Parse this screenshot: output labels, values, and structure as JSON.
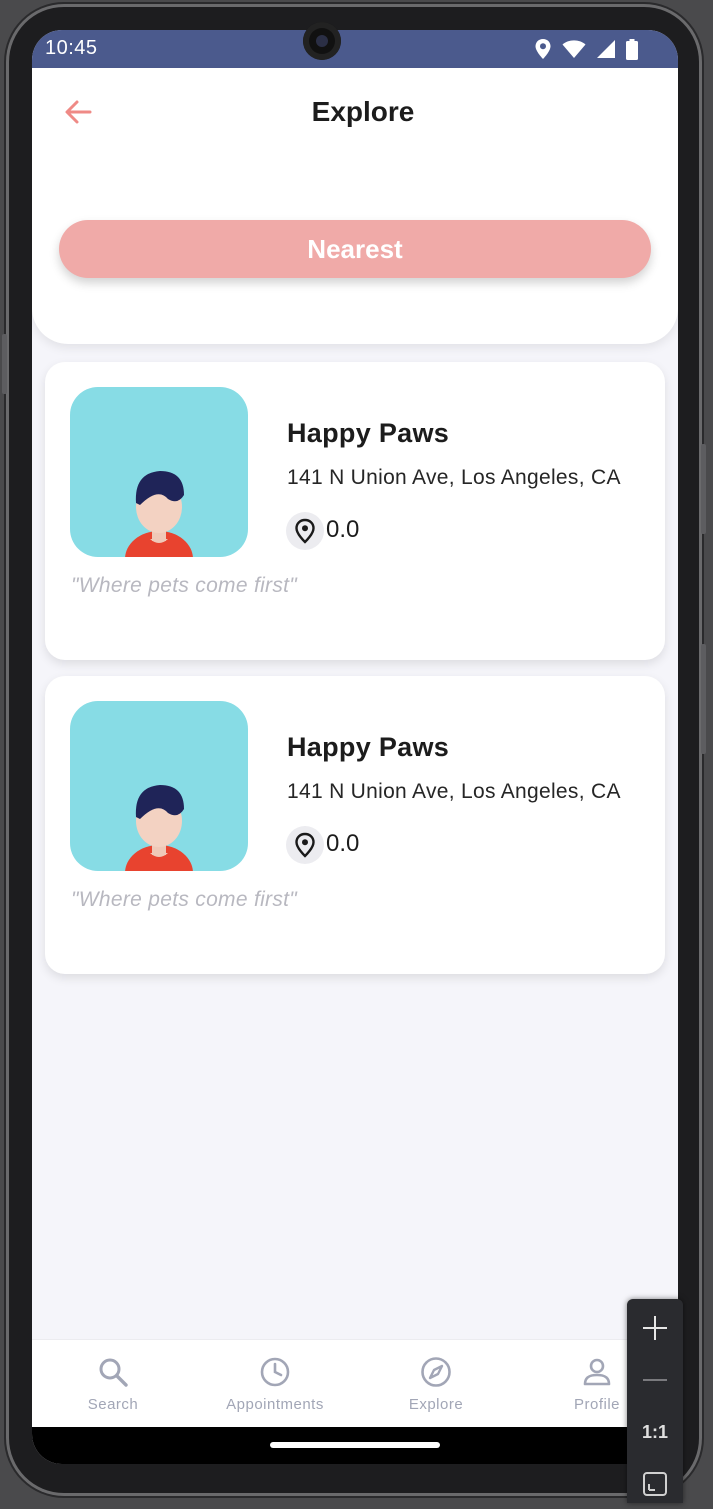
{
  "status_bar": {
    "time": "10:45",
    "icons": [
      "location-icon",
      "wifi-icon",
      "signal-icon",
      "battery-icon"
    ]
  },
  "header": {
    "title": "Explore",
    "back_icon": "arrow-left-icon",
    "filter_button": "Nearest"
  },
  "colors": {
    "accent": "#f0aaa8",
    "back_arrow": "#ef8a86",
    "status_bar": "#4b5a8d",
    "avatar_bg": "#87dce5",
    "nav_inactive": "#a2a6b6"
  },
  "results": [
    {
      "name": "Happy Paws",
      "address": "141 N Union Ave, Los Angeles, CA",
      "distance": "0.0",
      "tagline": "\"Where pets come first\"",
      "distance_icon": "map-pin-icon"
    },
    {
      "name": "Happy Paws",
      "address": "141 N Union Ave, Los Angeles, CA",
      "distance": "0.0",
      "tagline": "\"Where pets come first\"",
      "distance_icon": "map-pin-icon"
    }
  ],
  "bottom_nav": [
    {
      "label": "Search",
      "icon": "search-icon"
    },
    {
      "label": "Appointments",
      "icon": "clock-icon"
    },
    {
      "label": "Explore",
      "icon": "compass-icon"
    },
    {
      "label": "Profile",
      "icon": "person-icon"
    }
  ],
  "zoom_controls": {
    "zoom_in_icon": "plus-icon",
    "zoom_out_icon": "minus-icon",
    "actual_size_label": "1:1",
    "fit_icon": "fit-screen-icon"
  }
}
